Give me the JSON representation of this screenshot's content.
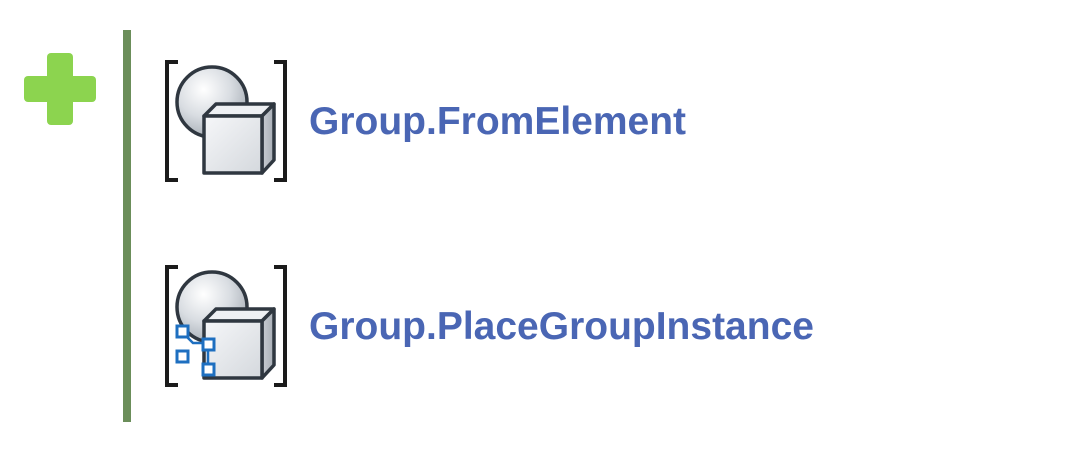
{
  "category": {
    "icon": "plus-icon",
    "color": "#8cd44f",
    "bar_color": "#6b8e5a"
  },
  "nodes": [
    {
      "label": "Group.FromElement",
      "icon": "group-from-element-icon"
    },
    {
      "label": "Group.PlaceGroupInstance",
      "icon": "group-place-instance-icon"
    }
  ],
  "colors": {
    "label": "#4a66b4",
    "accent_blue": "#1e6fc0"
  }
}
